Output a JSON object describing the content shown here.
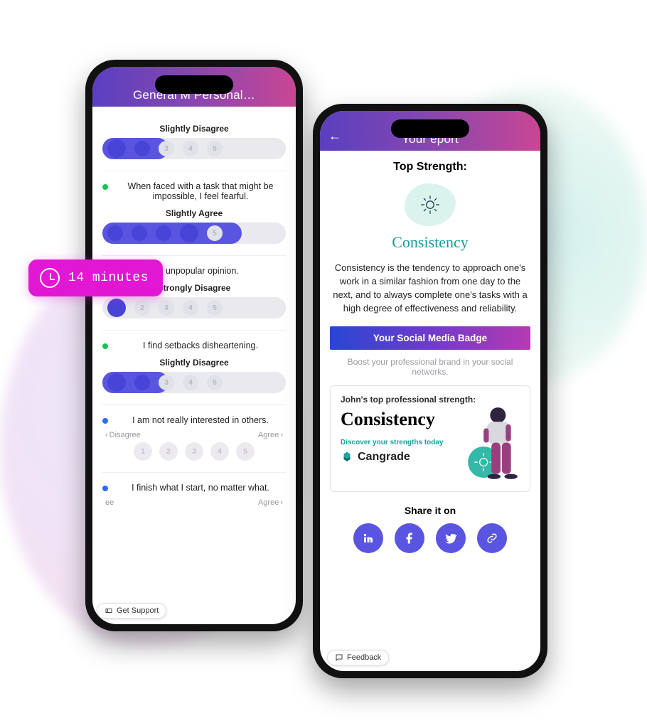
{
  "time_pill": "14 minutes",
  "left": {
    "title": "General M          Personal…",
    "q1": {
      "label": "Slightly Disagree"
    },
    "q2": {
      "text": "When faced with a task that might be impossible, I feel fearful.",
      "label": "Slightly Agree"
    },
    "q3": {
      "text": "e to express an unpopular opinion.",
      "label": "Strongly Disagree"
    },
    "q4": {
      "text": "I find setbacks disheartening.",
      "label": "Slightly Disagree"
    },
    "q5": {
      "text": "I am not really interested in others.",
      "left": "Disagree",
      "right": "Agree"
    },
    "q6": {
      "text": "I finish what I start, no matter what.",
      "left": "ee",
      "right": "Agree"
    },
    "support": "Get Support"
  },
  "right": {
    "title": "Your              eport",
    "top_h": "Top Strength:",
    "strength": "Consistency",
    "desc": "Consistency is the tendency to approach one's work in a similar fashion from one day to the next, and to always complete one's tasks with a high degree of effectiveness and reliability.",
    "badge_banner": "Your Social Media Badge",
    "badge_sub": "Boost your professional brand in your social networks.",
    "card_top": "John's top professional strength:",
    "card_big": "Consistency",
    "card_tag": "Discover your strengths today",
    "brand": "Cangrade",
    "share_title": "Share it on",
    "feedback": "Feedback"
  }
}
